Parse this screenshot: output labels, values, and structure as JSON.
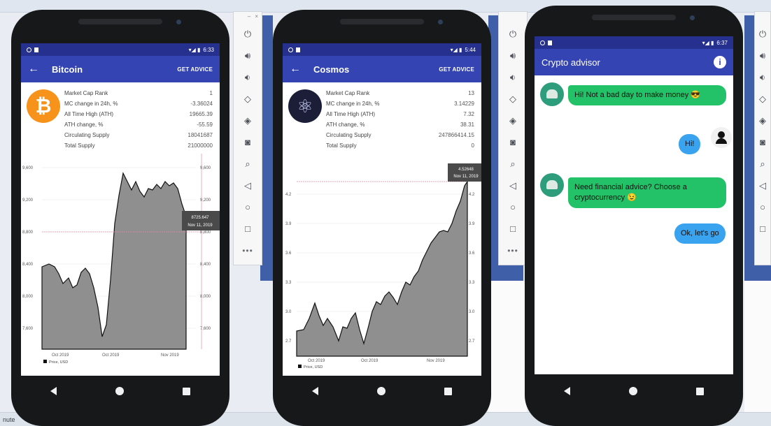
{
  "desktop": {
    "bottom_texts": [
      "nute"
    ]
  },
  "emulator_toolbar": {
    "buttons": [
      "power-icon",
      "volume-up-icon",
      "volume-down-icon",
      "rotate-left-icon",
      "rotate-right-icon",
      "camera-icon",
      "zoom-icon",
      "back-icon",
      "home-icon",
      "overview-icon",
      "more-icon"
    ],
    "close_glyph": "×",
    "min_glyph": "–",
    "more_glyph": "•••"
  },
  "phones": [
    {
      "status_time": "6:33",
      "app_title": "Bitcoin",
      "action": "GET ADVICE",
      "logo_color": "#f7931a",
      "logo_glyph": "₿",
      "stats": [
        {
          "label": "Market Cap Rank",
          "value": "1"
        },
        {
          "label": "MC change in 24h, %",
          "value": "-3.36024"
        },
        {
          "label": "All Time High (ATH)",
          "value": "19665.39"
        },
        {
          "label": "ATH change, %",
          "value": "-55.59"
        },
        {
          "label": "Circulating Supply",
          "value": "18041687"
        },
        {
          "label": "Total Supply",
          "value": "21000000"
        }
      ],
      "chart": {
        "y_ticks": [
          "9,600",
          "9,200",
          "8,800",
          "8,400",
          "8,000",
          "7,600"
        ],
        "x_ticks": [
          "Oct 2019",
          "Oct 2019",
          "Nov 2019"
        ],
        "legend": "Price, USD",
        "tooltip_value": "8725.647",
        "tooltip_date": "Nov 11, 2019"
      }
    },
    {
      "status_time": "5:44",
      "app_title": "Cosmos",
      "action": "GET ADVICE",
      "logo_color": "#1b1e36",
      "logo_glyph": "⚛",
      "stats": [
        {
          "label": "Market Cap Rank",
          "value": "13"
        },
        {
          "label": "MC change in 24h, %",
          "value": "3.14229"
        },
        {
          "label": "All Time High (ATH)",
          "value": "7.32"
        },
        {
          "label": "ATH change, %",
          "value": "38.31"
        },
        {
          "label": "Circulating Supply",
          "value": "247866414.15"
        },
        {
          "label": "Total Supply",
          "value": "0"
        }
      ],
      "chart": {
        "y_ticks": [
          "4.2",
          "3.9",
          "3.6",
          "3.3",
          "3.0",
          "2.7"
        ],
        "x_ticks": [
          "Oct 2019",
          "Oct 2019",
          "Nov 2019"
        ],
        "legend": "Price, USD",
        "tooltip_value": "4.52648",
        "tooltip_date": "Nov 11, 2019"
      }
    },
    {
      "status_time": "6:37",
      "app_title": "Crypto advisor",
      "info_glyph": "i",
      "messages": [
        {
          "from": "bot",
          "text": "Hi! Not a bad day to make money 😎"
        },
        {
          "from": "user",
          "text": "Hi!"
        },
        {
          "from": "bot",
          "text": "Need financial advice? Choose a cryptocurrency 😉"
        },
        {
          "from": "user",
          "text": "Ok, let's go"
        }
      ]
    }
  ],
  "colors": {
    "status_bar": "#25308f",
    "app_bar": "#3544b3",
    "bot_bubble": "#23c268",
    "user_bubble": "#3aa3ef",
    "chart_fill": "#8f8f8f"
  }
}
